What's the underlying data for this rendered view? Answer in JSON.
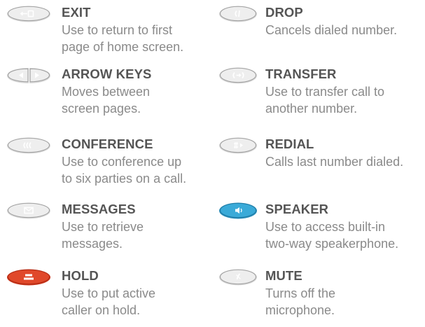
{
  "keys": [
    {
      "name": "exit",
      "title": "EXIT",
      "description": "Use to return to first\npage of home screen.",
      "icon": "exit-icon",
      "color": "#e6e6e6"
    },
    {
      "name": "drop",
      "title": "DROP",
      "description": "Cancels dialed number.",
      "icon": "drop-icon",
      "color": "#e6e6e6"
    },
    {
      "name": "arrow-keys",
      "title": "ARROW KEYS",
      "description": "Moves between\nscreen pages.",
      "icon": "arrow-keys-icon",
      "color": "#e6e6e6"
    },
    {
      "name": "transfer",
      "title": "TRANSFER",
      "description": "Use to transfer call to\nanother number.",
      "icon": "transfer-icon",
      "color": "#e6e6e6"
    },
    {
      "name": "conference",
      "title": "CONFERENCE",
      "description": "Use to conference up\nto six parties on a call.",
      "icon": "conference-icon",
      "color": "#e6e6e6"
    },
    {
      "name": "redial",
      "title": "REDIAL",
      "description": "Calls last number dialed.",
      "icon": "redial-icon",
      "color": "#e6e6e6"
    },
    {
      "name": "messages",
      "title": "MESSAGES",
      "description": "Use to retrieve\nmessages.",
      "icon": "envelope-icon",
      "color": "#e6e6e6"
    },
    {
      "name": "speaker",
      "title": "SPEAKER",
      "description": "Use to access built-in\ntwo-way speakerphone.",
      "icon": "speaker-icon",
      "color": "#3aaad8"
    },
    {
      "name": "hold",
      "title": "HOLD",
      "description": "Use to put active\ncaller on hold.",
      "icon": "hold-icon",
      "color": "#e0482a"
    },
    {
      "name": "mute",
      "title": "MUTE",
      "description": "Turns off the\nmicrophone.",
      "icon": "mute-icon",
      "color": "#e6e6e6"
    }
  ]
}
